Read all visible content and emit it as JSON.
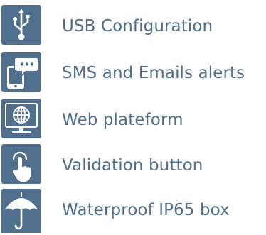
{
  "theme": {
    "accent": "#4f6f8d",
    "icon_fg": "#ffffff",
    "background": "#ffffff"
  },
  "features": [
    {
      "icon": "usb-icon",
      "label": "USB Configuration"
    },
    {
      "icon": "phone-message-icon",
      "label": "SMS and Emails alerts"
    },
    {
      "icon": "globe-monitor-icon",
      "label": "Web plateform"
    },
    {
      "icon": "finger-press-icon",
      "label": "Validation button"
    },
    {
      "icon": "umbrella-icon",
      "label": "Waterproof IP65 box"
    }
  ]
}
